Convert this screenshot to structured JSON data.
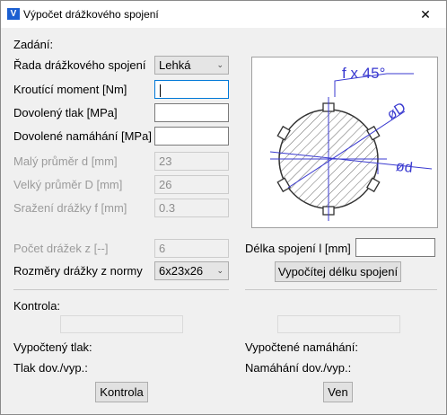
{
  "window": {
    "title": "Výpočet drážkového spojení",
    "close_symbol": "✕"
  },
  "sections": {
    "zadani": "Zadání:",
    "kontrola": "Kontrola:"
  },
  "fields": {
    "rada_label": "Řada drážkového spojení",
    "rada_value": "Lehká",
    "moment_label": "Kroutící moment [Nm]",
    "moment_value": "",
    "tlak_label": "Dovolený tlak [MPa]",
    "tlak_value": "",
    "namahani_label": "Dovolené namáhání [MPa]",
    "namahani_value": "",
    "d_label": "Malý průměr d [mm]",
    "d_value": "23",
    "D_label": "Velký průměr D [mm]",
    "D_value": "26",
    "f_label": "Sražení drážky f [mm]",
    "f_value": "0.3",
    "z_label": "Počet drážek z [--]",
    "z_value": "6",
    "rozmery_label": "Rozměry drážky z normy",
    "rozmery_value": "6x23x26",
    "delka_label": "Délka spojení l [mm]",
    "delka_value": ""
  },
  "buttons": {
    "vypocet": "Vypočítej délku spojení",
    "kontrola": "Kontrola",
    "ven": "Ven"
  },
  "results": {
    "tlak_label": "Vypočtený tlak:",
    "tlak_dov_label": "Tlak dov./vyp.:",
    "namahani_label": "Vypočtené namáhání:",
    "namahani_dov_label": "Namáhání dov./vyp.:"
  },
  "diagram": {
    "f_label": "f x 45°",
    "D_label": "øD",
    "d_label": "ød"
  }
}
